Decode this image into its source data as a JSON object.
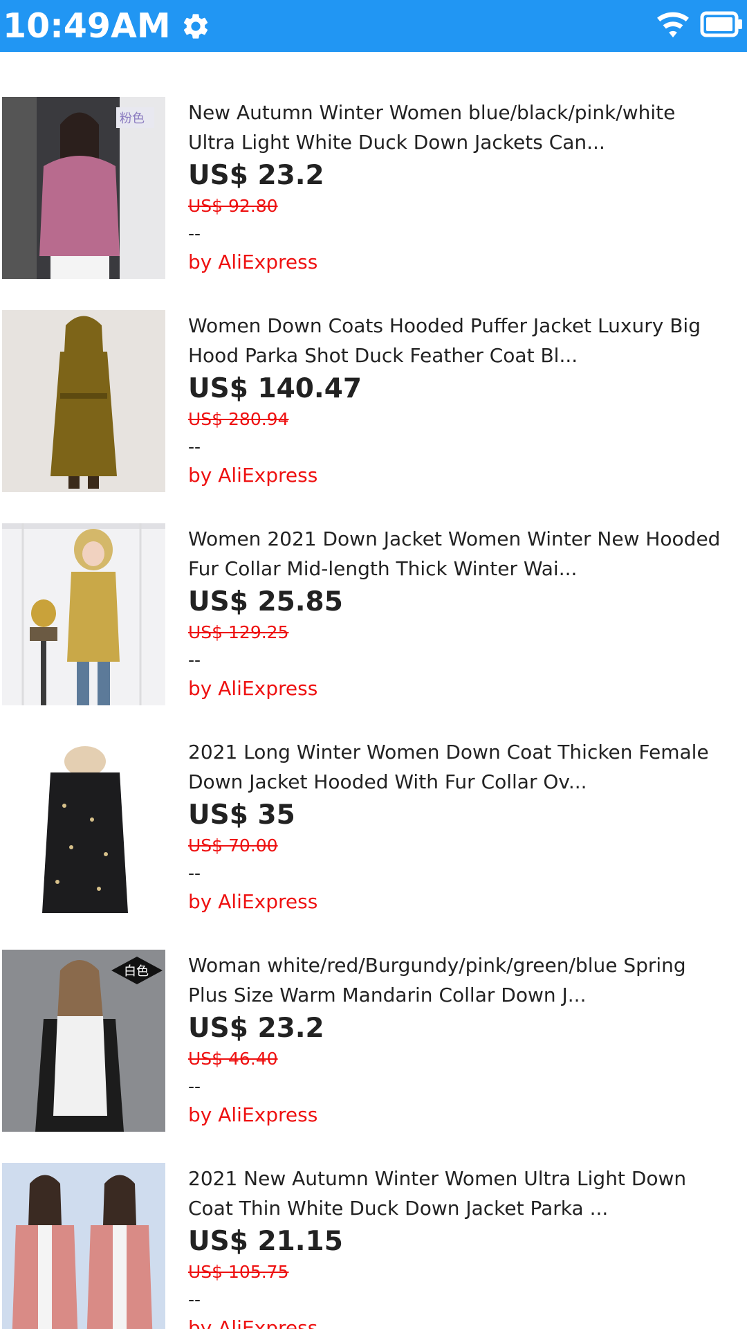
{
  "status_bar": {
    "time": "10:49AM",
    "settings_icon": "gear-icon",
    "wifi_icon": "wifi-icon",
    "battery_icon": "battery-icon",
    "background": "#2196F3"
  },
  "products": [
    {
      "title_line1": "New Autumn Winter Women blue/black/pink/white",
      "title_line2": "Ultra Light White Duck Down Jackets Can...",
      "price": "US$ 23.2",
      "original_price": "US$ 92.80",
      "rating": "--",
      "seller": "by AliExpress",
      "thumb_badge": "粉色",
      "thumb_color": "#b86b8e"
    },
    {
      "title_line1": "Women Down Coats Hooded Puffer Jacket Luxury Big",
      "title_line2": "Hood Parka Shot Duck Feather Coat Bl...",
      "price": "US$ 140.47",
      "original_price": "US$ 280.94",
      "rating": "--",
      "seller": "by AliExpress",
      "thumb_badge": "",
      "thumb_color": "#7d6418"
    },
    {
      "title_line1": "Women 2021 Down Jacket Women Winter New Hooded",
      "title_line2": "Fur Collar Mid-length Thick Winter Wai...",
      "price": "US$ 25.85",
      "original_price": "US$ 129.25",
      "rating": "--",
      "seller": "by AliExpress",
      "thumb_badge": "",
      "thumb_color": "#c9a848"
    },
    {
      "title_line1": "2021 Long Winter Women Down Coat Thicken Female",
      "title_line2": "Down Jacket Hooded With Fur Collar Ov...",
      "price": "US$ 35",
      "original_price": "US$ 70.00",
      "rating": "--",
      "seller": "by AliExpress",
      "thumb_badge": "",
      "thumb_color": "#1c1c1e"
    },
    {
      "title_line1": "Woman white/red/Burgundy/pink/green/blue Spring",
      "title_line2": "Plus Size Warm Mandarin Collar Down J...",
      "price": "US$ 23.2",
      "original_price": "US$ 46.40",
      "rating": "--",
      "seller": "by AliExpress",
      "thumb_badge": "白色",
      "thumb_color": "#f1f1f1"
    },
    {
      "title_line1": "2021 New Autumn Winter Women Ultra Light Down",
      "title_line2": "Coat Thin White Duck Down Jacket Parka ...",
      "price": "US$ 21.15",
      "original_price": "US$ 105.75",
      "rating": "--",
      "seller": "by AliExpress",
      "thumb_badge": "",
      "thumb_color": "#d98b86"
    }
  ]
}
